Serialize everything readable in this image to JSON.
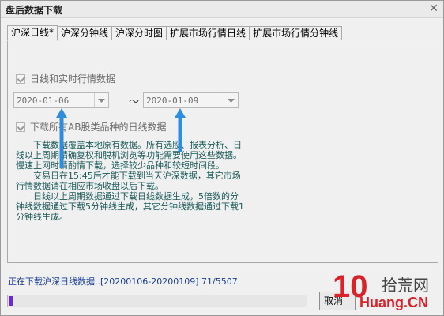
{
  "window": {
    "title": "盘后数据下载",
    "close_glyph": "✕"
  },
  "tabs": [
    {
      "label": "沪深日线*",
      "active": true
    },
    {
      "label": "沪深分钟线",
      "active": false
    },
    {
      "label": "沪深分时图",
      "active": false
    },
    {
      "label": "扩展市场行情日线",
      "active": false
    },
    {
      "label": "扩展市场行情分钟线",
      "active": false
    }
  ],
  "options": {
    "daily_realtime_label": "日线和实时行情数据",
    "daily_realtime_checked": true,
    "start_date": "2020-01-06",
    "end_date": "2020-01-09",
    "range_separator": "～",
    "all_ab_label": "下载所有AB股类品种的日线数据",
    "all_ab_checked": true
  },
  "description": {
    "para1": "下载数据覆盖本地原有数据。所有选股、报表分析、日线以上周期精确复权和脱机浏览等功能需要使用这些数据。慢速上网时请酌情下载，选择较少品种和较短时间段。",
    "para2": "交易日在15:45后才能下载到当天沪深数据，其它市场行情数据请在相应市场收盘以后下载。",
    "para3": "日线以上周期数据通过下载日线数据生成，5倍数的分钟线数据通过下载5分钟线生成，其它分钟线数据通过下载1分钟线生成。"
  },
  "status": {
    "text": "正在下载沪深日线数据..[20200106-20200109] 71/5507",
    "progress_fraction": 0.0129
  },
  "buttons": {
    "cancel_label": "取消"
  },
  "watermark": {
    "number": "10",
    "site_cn": "拾荒网",
    "url": "Huang.CN"
  },
  "colors": {
    "progress": "#6a2bd6",
    "status_text": "#1a3d9c",
    "description_text": "#1c5a5a",
    "annotation_arrow": "#2f8de0"
  }
}
